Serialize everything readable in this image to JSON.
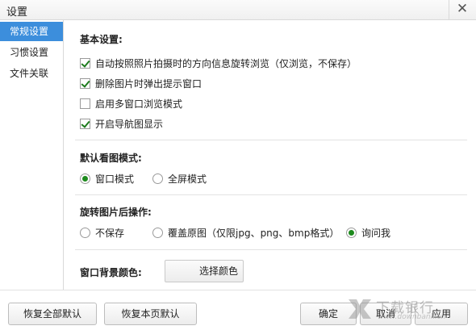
{
  "window": {
    "title": "设置",
    "close_glyph": "✕"
  },
  "sidebar": {
    "items": [
      {
        "label": "常规设置",
        "active": true
      },
      {
        "label": "习惯设置",
        "active": false
      },
      {
        "label": "文件关联",
        "active": false
      }
    ]
  },
  "basic": {
    "title": "基本设置:",
    "options": [
      {
        "label": "自动按照照片拍摄时的方向信息旋转浏览（仅浏览，不保存）",
        "checked": true
      },
      {
        "label": "删除图片时弹出提示窗口",
        "checked": true
      },
      {
        "label": "启用多窗口浏览模式",
        "checked": false
      },
      {
        "label": "开启导航图显示",
        "checked": true
      }
    ]
  },
  "view_mode": {
    "title": "默认看图模式:",
    "options": [
      {
        "label": "窗口模式",
        "selected": true
      },
      {
        "label": "全屏模式",
        "selected": false
      }
    ]
  },
  "rotate": {
    "title": "旋转图片后操作:",
    "options": [
      {
        "label": "不保存",
        "selected": false
      },
      {
        "label": "覆盖原图（仅限jpg、png、bmp格式）",
        "selected": false
      },
      {
        "label": "询问我",
        "selected": true
      }
    ]
  },
  "background": {
    "title": "窗口背景颜色:",
    "button_label": "选择颜色"
  },
  "footer": {
    "restore_all": "恢复全部默认",
    "restore_page": "恢复本页默认",
    "ok": "确定",
    "cancel": "取消",
    "apply": "应用"
  },
  "watermark": {
    "text": "下载银行",
    "sub": "www.downbank.cn"
  },
  "colors": {
    "accent": "#3c8edc",
    "check": "#1d7a1d"
  }
}
